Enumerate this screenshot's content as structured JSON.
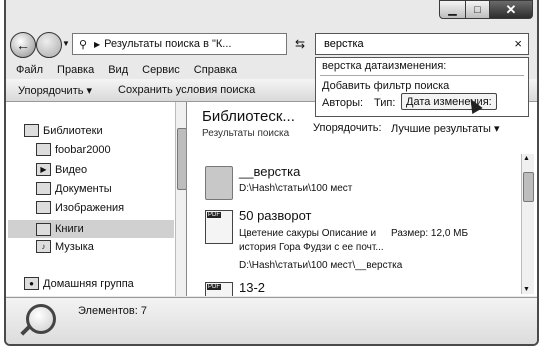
{
  "address": {
    "path": "Результаты поиска в \"К..."
  },
  "search": {
    "value": "верстка"
  },
  "search_dropdown": {
    "history_item": "верстка датаизменения:",
    "add_filter": "Добавить фильтр поиска",
    "filters": [
      "Авторы:",
      "Тип:",
      "Дата изменения:"
    ]
  },
  "menu": [
    "Файл",
    "Правка",
    "Вид",
    "Сервис",
    "Справка"
  ],
  "toolbar": {
    "organize": "Упорядочить ▾",
    "save_search": "Сохранить условия поиска"
  },
  "nav": {
    "items": [
      {
        "label": "Библиотеки"
      },
      {
        "label": "foobar2000"
      },
      {
        "label": "Видео"
      },
      {
        "label": "Документы"
      },
      {
        "label": "Изображения"
      },
      {
        "label": "Книги"
      },
      {
        "label": "Музыка"
      },
      {
        "label": "Домашняя группа"
      }
    ],
    "selected": "Книги"
  },
  "content": {
    "title": "Библиотеск...",
    "subtitle": "Результаты поиска",
    "arrange_label": "Упорядочить:",
    "arrange_value": "Лучшие результаты ▾",
    "results": [
      {
        "name": "__верстка",
        "path": "D:\\Hash\\статьи\\100 мест"
      },
      {
        "name": "50 разворот",
        "desc1": "Цветение сакуры Описание и",
        "desc2": "история Гора Фудзи с ее почт...",
        "size": "Размер: 12,0 МБ",
        "path": "D:\\Hash\\статьи\\100 мест\\__верстка"
      },
      {
        "name": "13-2"
      }
    ]
  },
  "status": {
    "text": "Элементов: 7"
  }
}
